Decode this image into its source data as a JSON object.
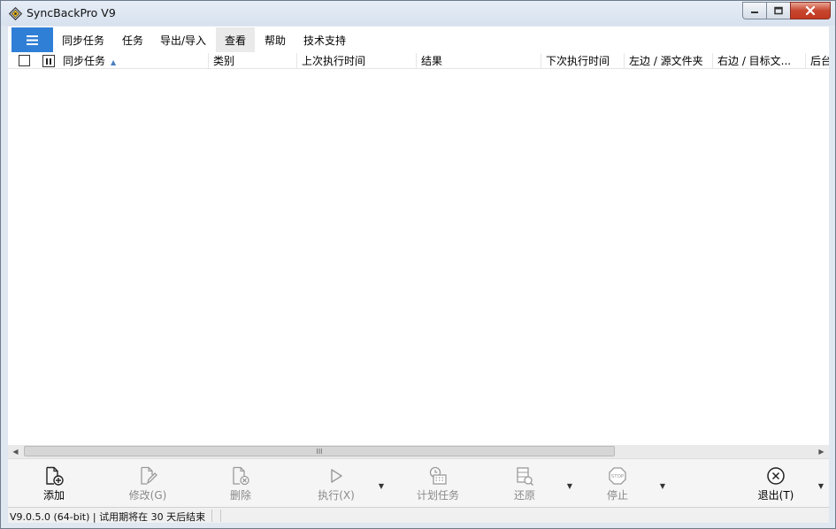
{
  "window": {
    "title": "SyncBackPro V9"
  },
  "menu": {
    "items": [
      "同步任务",
      "任务",
      "导出/导入",
      "查看",
      "帮助",
      "技术支持"
    ],
    "active": "查看"
  },
  "list": {
    "columns": [
      "同步任务",
      "类别",
      "上次执行时间",
      "结果",
      "下次执行时间",
      "左边 / 源文件夹",
      "右边 / 目标文...",
      "后台"
    ],
    "sorted_column": "同步任务",
    "sort_direction": "ascending",
    "rows": []
  },
  "scrollbar": {
    "grip": "III"
  },
  "toolbar": {
    "add": "添加",
    "modify": "修改(G)",
    "delete": "删除",
    "run": "执行(X)",
    "schedule": "计划任务",
    "restore": "还原",
    "stop": "停止",
    "stop_icon_text": "STOP",
    "exit": "退出(T)"
  },
  "status": {
    "text": "V9.0.5.0 (64-bit) | 试用期将在 30 天后结束"
  },
  "colors": {
    "accent": "#2f7fd6",
    "close_button": "#c7452e"
  }
}
